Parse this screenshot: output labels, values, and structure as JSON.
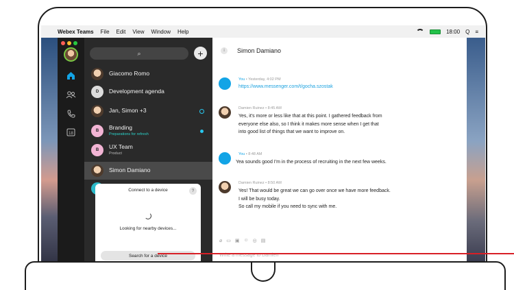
{
  "menubar": {
    "app_name": "Webex Teams",
    "menu_items": [
      "File",
      "Edit",
      "View",
      "Window",
      "Help"
    ],
    "clock": "18:00",
    "apple_glyph": "",
    "search_glyph": "Q",
    "menu_glyph": "≡"
  },
  "traffic_colors": [
    "#fe5f57",
    "#febc2e",
    "#28c840"
  ],
  "rail": {
    "icons": [
      "home-icon",
      "people-icon",
      "phone-icon",
      "calendar-icon"
    ],
    "calendar_day": "18"
  },
  "list": {
    "search_glyph": "⌕",
    "plus_glyph": "+",
    "items": [
      {
        "name": "Giacomo Romo",
        "sub": "",
        "initial": "",
        "indicator": ""
      },
      {
        "name": "Development agenda",
        "sub": "",
        "initial": "D",
        "indicator": ""
      },
      {
        "name": "Jan, Simon +3",
        "sub": "",
        "initial": "",
        "indicator": "ring"
      },
      {
        "name": "Branding",
        "sub": "Preparations for refresh",
        "initial": "B",
        "indicator": "dot"
      },
      {
        "name": "UX Team",
        "sub": "Product",
        "initial": "B",
        "indicator": ""
      },
      {
        "name": "Simon Damiano",
        "sub": "",
        "initial": "",
        "indicator": ""
      }
    ]
  },
  "popup": {
    "title": "Connect to a device",
    "help": "?",
    "status": "Looking for nearby devices...",
    "button": "Search for a device"
  },
  "conversation": {
    "title": "Simon Damiano",
    "info_glyph": "i",
    "messages": [
      {
        "author": "You",
        "time": " • Yesterday, 4:02 PM",
        "lines": [
          "https://www.messenger.com/t/gocha.szostak"
        ]
      },
      {
        "author": "Damien Ruinez",
        "time": " • 8:45 AM",
        "lines": [
          "Yes, it's more or less like that at this point. I gathered feedback from",
          "everyone else also, so I think it makes more sense when I get that",
          "into good list of things that we want to improve on."
        ]
      },
      {
        "author": "You",
        "time": " • 8:48 AM",
        "lines": [
          "Yea sounds good I'm in the process of recruiting in the next few weeks."
        ]
      },
      {
        "author": "Damien Ruinez",
        "time": " • 8:50 AM",
        "lines": [
          "Yes! That would be great we can go over once we have more feedback.",
          "I will be busy today.",
          "So call my mobile if you need to sync with me."
        ]
      }
    ],
    "composer_placeholder": "Write a message to Damien",
    "composer_icons": [
      "paperclip-icon",
      "whiteboard-icon",
      "file-icon",
      "emoji-icon",
      "gif-icon",
      "image-icon"
    ]
  }
}
